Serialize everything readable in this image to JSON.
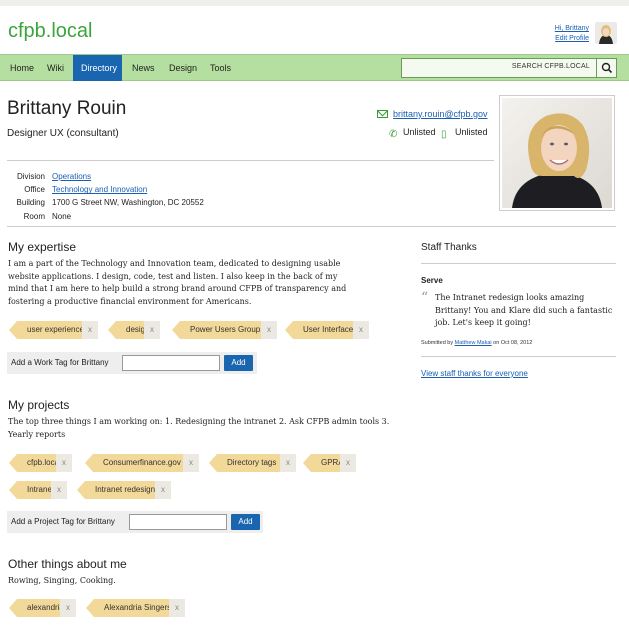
{
  "app": {
    "brand": "cfpb.local"
  },
  "user_menu": {
    "greeting": "Hi, Brittany",
    "edit_profile": "Edit Profile"
  },
  "nav": {
    "items": [
      {
        "label": "Home",
        "active": false
      },
      {
        "label": "Wiki",
        "active": false
      },
      {
        "label": "Directory",
        "active": true
      },
      {
        "label": "News",
        "active": false
      },
      {
        "label": "Design",
        "active": false
      },
      {
        "label": "Tools",
        "active": false
      }
    ],
    "search_placeholder": "SEARCH CFPB.LOCAL",
    "search_icon": "search-icon"
  },
  "profile": {
    "name": "Brittany Rouin",
    "title": "Designer UX (consultant)",
    "email": "brittany.rouin@cfpb.gov",
    "phone_office": "Unlisted",
    "phone_mobile": "Unlisted",
    "info": {
      "division_label": "Division",
      "division": "Operations",
      "office_label": "Office",
      "office": "Technology and Innovation",
      "building_label": "Building",
      "building": "1700 G Street NW, Washington, DC 20552",
      "room_label": "Room",
      "room": "None"
    }
  },
  "expertise": {
    "heading": "My expertise",
    "text": "I am a part of the Technology and Innovation team, dedicated to designing usable website applications. I design, code, test and listen. I also keep in the back of my mind that I am here to help build a strong brand around CFPB of transparency and fostering a productive financial environment for Americans.",
    "tags": [
      "user experience",
      "design",
      "Power Users Group",
      "User Interface"
    ],
    "add_label": "Add a Work Tag for Brittany",
    "add_button": "Add"
  },
  "projects": {
    "heading": "My projects",
    "text": "The top three things I am working on: 1. Redesigning the intranet 2. Ask CFPB admin tools 3. Yearly reports",
    "tags": [
      "cfpb.local",
      "Consumerfinance.gov",
      "Directory tags",
      "GPRA",
      "Intranet",
      "Intranet redesign"
    ],
    "add_label": "Add a Project Tag for Brittany",
    "add_button": "Add"
  },
  "other": {
    "heading": "Other things about me",
    "text": "Rowing, Singing, Cooking.",
    "tags": [
      "alexandria",
      "Alexandria Singers"
    ]
  },
  "staff_thanks": {
    "heading": "Staff Thanks",
    "category": "Serve",
    "quote": "The Intranet redesign looks amazing Brittany! You and Klare did such a fantastic job. Let's keep it going!",
    "submitted_prefix": "Submitted by",
    "submitted_by": "Matthew Makai",
    "submitted_date": "on Oct 08, 2012",
    "view_all": "View staff thanks for everyone"
  },
  "tag_remove_symbol": "x",
  "colors": {
    "brand_green": "#3aa63a",
    "nav_bg": "#b4dfa0",
    "nav_active": "#1a65b0",
    "tag_bg": "#f2d999"
  }
}
